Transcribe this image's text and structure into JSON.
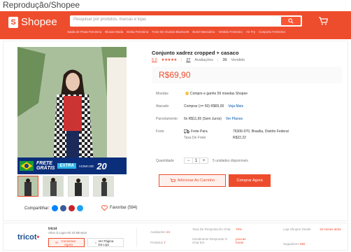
{
  "caption": "Reprodução/Shopee",
  "header": {
    "logo": "Shopee",
    "search_placeholder": "Pesquisar por produtos, marcas e lojas",
    "keywords": [
      "Saida de Praia Feminina",
      "Blusas Moda",
      "Bolsa Feminina",
      "Fone De Ouvido Bluetooth",
      "Boné Masculino",
      "Vestido Feminino",
      "Air Fry",
      "Conjunto Feminino"
    ]
  },
  "product": {
    "title": "Conjunto xadrez cropped + casaco",
    "rating": "5.0",
    "stars": "★★★★★",
    "reviews_count": "27",
    "reviews_label": "Avaliações",
    "sold_count": "39",
    "sold_label": "Vendido",
    "price": "R$69,90",
    "rows": {
      "moedas_label": "Moedas",
      "moedas_text": "Compre e ganhe 59 moedas Shopee",
      "atacado_label": "Atacado",
      "atacado_text": "Comprar (>= 50) R$65,00",
      "atacado_link": "Veja Mais",
      "parcel_label": "Parcelamento",
      "parcel_text": "6x R$11,65 (Sem Juros)",
      "parcel_link": "Ver Planos",
      "frete_label": "Frete",
      "frete_para": "Frete Para",
      "frete_dest": "76306-070, Brasilia, Distrito Federal",
      "frete_taxa": "Taxa De Frete",
      "frete_valor": "R$22,22",
      "qty_label": "Quantidade",
      "qty_minus": "−",
      "qty_value": "1",
      "qty_plus": "+",
      "qty_avail": "5 unidades disponíveis"
    },
    "btn_cart": "Adicionar Ao Carrinho",
    "btn_buy": "Comprar Agora",
    "share_label": "Compartilhar:",
    "fav_label": "Favoritar (594)",
    "banner": {
      "line1": "FRETE",
      "line2": "GRÁTIS",
      "extra": "EXTRA",
      "acima": "ACIMA DE",
      "valor": "20"
    }
  },
  "shop": {
    "logo": "tricot",
    "name": "tricot",
    "active": "Ativo à Logo Há 10 Minutos",
    "chat_btn": "Conversar Agora",
    "view_btn": "Ver Página Da Loja",
    "stats": [
      {
        "label": "Avaliações",
        "value": "24"
      },
      {
        "label": "Produtos",
        "value": "7"
      },
      {
        "label": "Taxa De Resposta Do Chat",
        "value": "75%"
      },
      {
        "label": "Geralmente Responde O Chat Em",
        "value": "poucas horas"
      },
      {
        "label": "Loja Shopee Desde",
        "value": "15 meses atrás"
      },
      {
        "label": "Seguidores",
        "value": "592"
      }
    ]
  },
  "colors": {
    "brand": "#ee4d2d",
    "link": "#0055aa"
  }
}
